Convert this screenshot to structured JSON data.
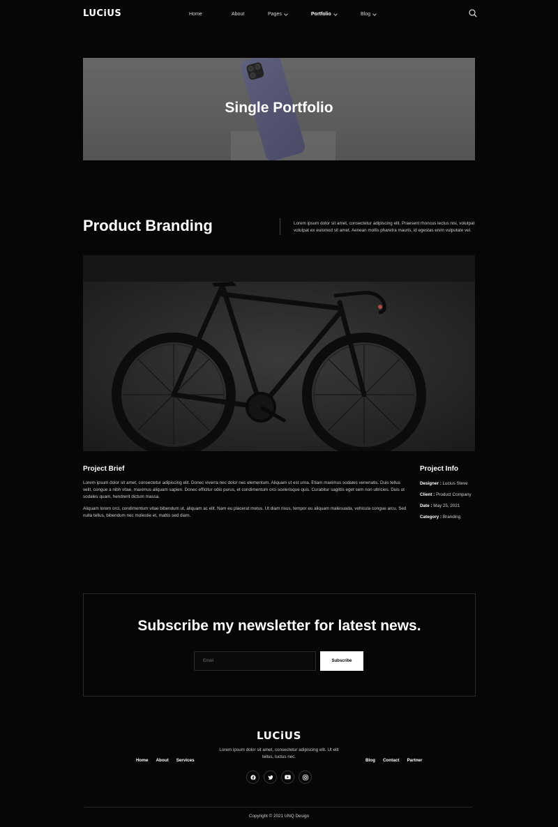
{
  "nav": {
    "logo": "LUCiUS",
    "items": [
      {
        "label": "Home",
        "dropdown": false,
        "active": false
      },
      {
        "label": "About",
        "dropdown": false,
        "active": false
      },
      {
        "label": "Pages",
        "dropdown": true,
        "active": false
      },
      {
        "label": "Portfolio",
        "dropdown": true,
        "active": true
      },
      {
        "label": "Blog",
        "dropdown": true,
        "active": false
      }
    ],
    "search_icon": "search-icon"
  },
  "hero": {
    "title": "Single Portfolio"
  },
  "branding": {
    "title": "Product Branding",
    "description": "Lorem ipsum dolor sit amet, consectetur adipiscing elit. Praesent rhoncus lectus nisi, volutpat volutpat ex euismod sit amet. Aenean mollis pharetra mauris, id egestas enim vulputate vel."
  },
  "brief": {
    "title": "Project Brief",
    "p1": "Lorem ipsum dolor sit amet, consectetur adipiscing elit. Donec viverra nec dolor nec elementum. Aliquam ut est urna. Etiam maximus sodales venenatis. Duis tellus velit, congue a nibh vitae, maximus aliquam sapien. Donec efficitur odio purus, et condimentum orci scelerisque quis. Curabitur sagittis eget sem non ultricies. Duis ut sodales quam, hendrerit dictum massa.",
    "p2": "Aliquam lorem orci, condimentum vitae bibendum ut, aliquam ac elit. Nam eu placerat metus. Ut diam risus, tempor eu aliquam malesuada, vehicula congue arcu. Sed nulla tellus, bibendum nec molestie et, mattis sed diam."
  },
  "info": {
    "title": "Project Info",
    "designer_label": "Designer :",
    "designer": "Lucius Steve",
    "client_label": "Client :",
    "client": "Product Company",
    "date_label": "Date :",
    "date": "May 25, 2021",
    "category_label": "Category :",
    "category": "Branding"
  },
  "newsletter": {
    "title": "Subscribe my newsletter for latest news.",
    "placeholder": "Email",
    "button": "Subscribe"
  },
  "footer": {
    "logo": "LUCiUS",
    "text": "Lorem ipsum dolor sit amet, consectetur adipiscing elit. Ut elit tellus, luctus nec.",
    "left_links": [
      "Home",
      "About",
      "Services"
    ],
    "right_links": [
      "Blog",
      "Contact",
      "Partner"
    ],
    "socials": [
      "facebook-icon",
      "twitter-icon",
      "youtube-icon",
      "instagram-icon"
    ],
    "copyright": "Copyright © 2021 UNQ Design"
  }
}
